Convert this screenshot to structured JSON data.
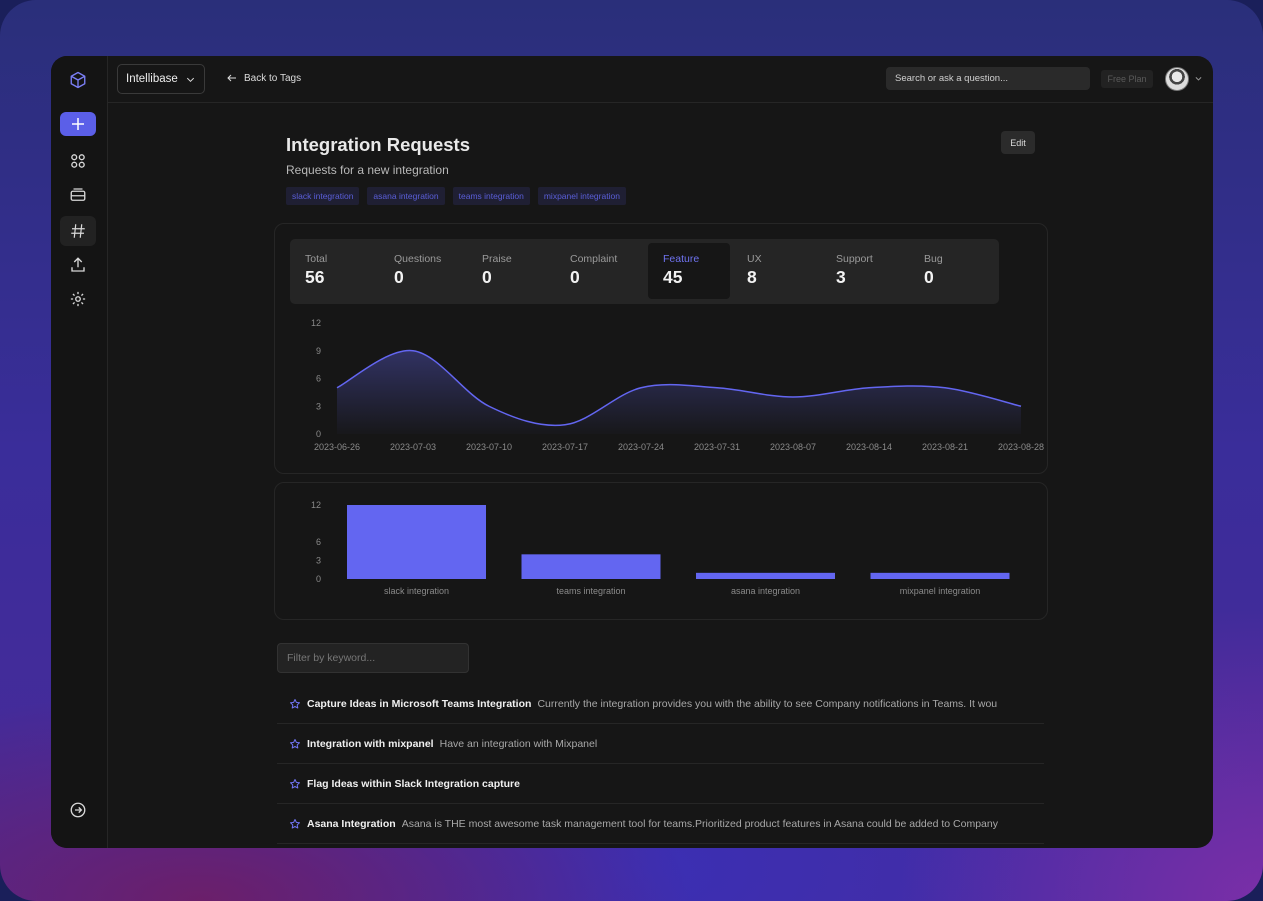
{
  "app": {
    "workspace": "Intellibase",
    "back_label": "Back to Tags",
    "search_placeholder": "Search or ask a question...",
    "plan_label": "Free Plan"
  },
  "page": {
    "title": "Integration Requests",
    "subtitle": "Requests for a new integration",
    "edit_label": "Edit",
    "tags": [
      "slack integration",
      "asana integration",
      "teams integration",
      "mixpanel integration"
    ]
  },
  "stats": [
    {
      "label": "Total",
      "value": "56"
    },
    {
      "label": "Questions",
      "value": "0"
    },
    {
      "label": "Praise",
      "value": "0"
    },
    {
      "label": "Complaint",
      "value": "0"
    },
    {
      "label": "Feature",
      "value": "45",
      "active": true
    },
    {
      "label": "UX",
      "value": "8"
    },
    {
      "label": "Support",
      "value": "3"
    },
    {
      "label": "Bug",
      "value": "0"
    }
  ],
  "colors": {
    "accent": "#6366f1"
  },
  "chart_data": [
    {
      "type": "area",
      "x": [
        "2023-06-26",
        "2023-07-03",
        "2023-07-10",
        "2023-07-17",
        "2023-07-24",
        "2023-07-31",
        "2023-08-07",
        "2023-08-14",
        "2023-08-21",
        "2023-08-28"
      ],
      "series": [
        {
          "values": [
            5,
            9,
            3,
            1,
            5,
            5,
            4,
            5,
            5,
            3
          ]
        }
      ],
      "yticks": [
        0,
        3,
        6,
        9,
        12
      ],
      "ylim": [
        0,
        12
      ]
    },
    {
      "type": "bar",
      "categories": [
        "slack integration",
        "teams integration",
        "asana integration",
        "mixpanel integration"
      ],
      "values": [
        12,
        4,
        1,
        1
      ],
      "yticks": [
        0,
        3,
        6,
        12
      ],
      "ylim": [
        0,
        12
      ]
    }
  ],
  "filter": {
    "placeholder": "Filter by keyword..."
  },
  "requests": [
    {
      "title": "Capture Ideas in Microsoft Teams Integration",
      "desc": "Currently the integration provides you with the ability to see Company notifications in Teams. It wou"
    },
    {
      "title": "Integration with mixpanel",
      "desc": "Have an integration with Mixpanel"
    },
    {
      "title": "Flag Ideas within Slack Integration capture",
      "desc": ""
    },
    {
      "title": "Asana Integration",
      "desc": "Asana is THE most awesome task management tool for teams.Prioritized product features in Asana could be added to Company"
    }
  ],
  "icons": {
    "logo": "cube-logo-icon",
    "sidebar": [
      "plus-icon",
      "grid-icon",
      "inbox-icon",
      "hash-icon",
      "upload-icon",
      "gear-icon",
      "logout-icon"
    ]
  }
}
